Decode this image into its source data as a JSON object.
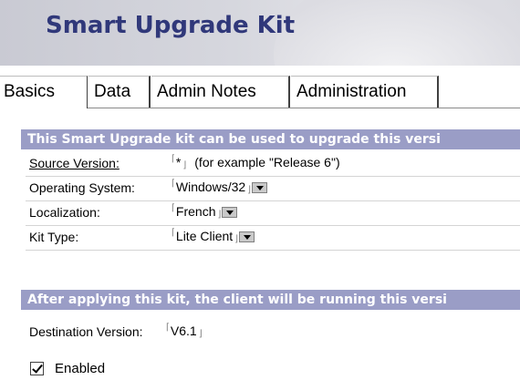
{
  "header": {
    "title": "Smart Upgrade Kit"
  },
  "tabs": [
    {
      "label": "Basics",
      "active": true
    },
    {
      "label": "Data"
    },
    {
      "label": "Admin Notes"
    },
    {
      "label": "Administration"
    }
  ],
  "section1": {
    "text": "This Smart Upgrade kit can be used to upgrade this versi"
  },
  "fields": {
    "source_version": {
      "label": "Source Version:",
      "value": "*",
      "hint": "(for example \"Release 6\")"
    },
    "operating_system": {
      "label": "Operating System:",
      "value": "Windows/32"
    },
    "localization": {
      "label": "Localization:",
      "value": "French"
    },
    "kit_type": {
      "label": "Kit Type:",
      "value": "Lite Client"
    }
  },
  "section2": {
    "text": "After applying this kit, the client will be running this versi"
  },
  "destination": {
    "label": "Destination Version:",
    "value": "V6.1"
  },
  "enabled": {
    "label": "Enabled",
    "checked": true
  },
  "colors": {
    "title": "#30387a",
    "section_bar": "#9a9dc6",
    "banner": "#d6d7de"
  },
  "icons": {
    "field_bracket_open": "⌈",
    "field_bracket_close": "⌋",
    "dropdown": "dropdown-arrow-icon"
  }
}
